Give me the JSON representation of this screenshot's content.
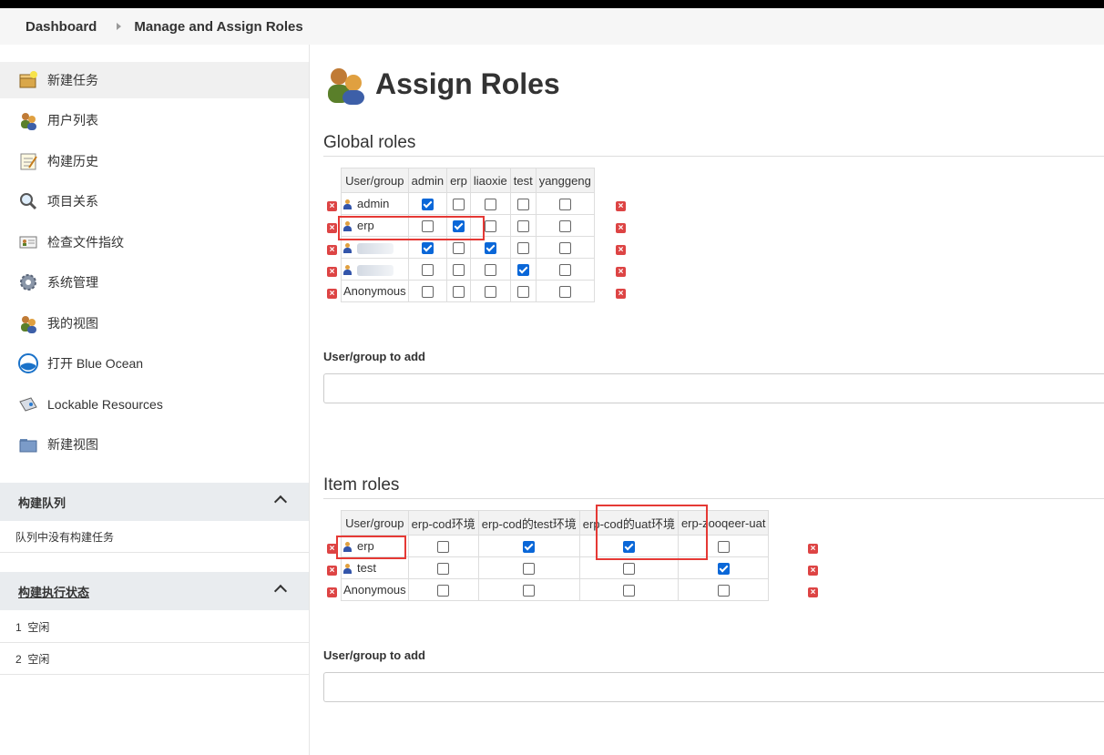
{
  "breadcrumb": {
    "home": "Dashboard",
    "current": "Manage and Assign Roles"
  },
  "sidebar": {
    "tasks": [
      {
        "label": "新建任务",
        "icon": "new-job-icon"
      },
      {
        "label": "用户列表",
        "icon": "users-icon"
      },
      {
        "label": "构建历史",
        "icon": "notepad-icon"
      },
      {
        "label": "项目关系",
        "icon": "search-icon"
      },
      {
        "label": "检查文件指纹",
        "icon": "fingerprint-icon"
      },
      {
        "label": "系统管理",
        "icon": "gear-icon"
      },
      {
        "label": "我的视图",
        "icon": "users-icon"
      },
      {
        "label": "打开 Blue Ocean",
        "icon": "blue-ocean-icon"
      },
      {
        "label": "Lockable Resources",
        "icon": "lock-resource-icon"
      },
      {
        "label": "新建视图",
        "icon": "folder-icon"
      }
    ],
    "build_queue": {
      "title": "构建队列",
      "empty": "队列中没有构建任务"
    },
    "executors": {
      "title": "构建执行状态",
      "items": [
        "1  空闲",
        "2  空闲"
      ]
    }
  },
  "main": {
    "title": "Assign Roles",
    "global": {
      "heading": "Global roles",
      "columns": [
        "User/group",
        "admin",
        "erp",
        "liaoxie",
        "test",
        "yanggeng"
      ],
      "rows": [
        {
          "name": "admin",
          "checks": [
            true,
            false,
            false,
            false,
            false
          ]
        },
        {
          "name": "erp",
          "checks": [
            false,
            true,
            false,
            false,
            false
          ]
        },
        {
          "name": "",
          "checks": [
            true,
            false,
            true,
            false,
            false
          ]
        },
        {
          "name": "",
          "checks": [
            false,
            false,
            false,
            true,
            false
          ]
        },
        {
          "name": "Anonymous",
          "checks": [
            false,
            false,
            false,
            false,
            false
          ]
        }
      ],
      "add_label": "User/group to add"
    },
    "item": {
      "heading": "Item roles",
      "columns": [
        "User/group",
        "erp-cod环境",
        "erp-cod的test环境",
        "erp-cod的uat环境",
        "erp-zooqeer-uat"
      ],
      "rows": [
        {
          "name": "erp",
          "checks": [
            false,
            true,
            true,
            false
          ]
        },
        {
          "name": "test",
          "checks": [
            false,
            false,
            false,
            true
          ]
        },
        {
          "name": "Anonymous",
          "checks": [
            false,
            false,
            false,
            false
          ]
        }
      ],
      "add_label": "User/group to add"
    }
  },
  "colors": {
    "accent": "#0a67d8",
    "highlight": "#e53935",
    "delete": "#dd4444"
  }
}
